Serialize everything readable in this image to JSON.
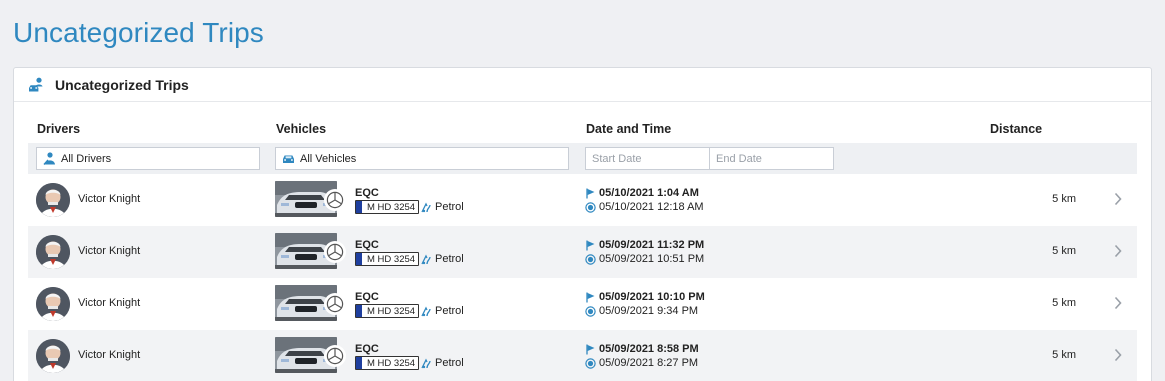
{
  "page": {
    "title": "Uncategorized Trips"
  },
  "card": {
    "title": "Uncategorized Trips",
    "header_icon": "car-user-icon"
  },
  "columns": {
    "drivers": "Drivers",
    "vehicles": "Vehicles",
    "date_time": "Date and Time",
    "distance": "Distance"
  },
  "filters": {
    "drivers": {
      "value": "All Drivers",
      "icon": "person-icon"
    },
    "vehicles": {
      "value": "All Vehicles",
      "icon": "car-icon"
    },
    "start_date": {
      "placeholder": "Start Date"
    },
    "end_date": {
      "placeholder": "End Date"
    }
  },
  "colors": {
    "accent": "#2f88c0",
    "plate_eu": "#1f3f9e"
  },
  "trips": [
    {
      "driver": "Victor Knight",
      "model": "EQC",
      "plate": "M HD 3254",
      "fuel": "Petrol",
      "end": "05/10/2021 1:04 AM",
      "start": "05/10/2021 12:18 AM",
      "distance": "5 km"
    },
    {
      "driver": "Victor Knight",
      "model": "EQC",
      "plate": "M HD 3254",
      "fuel": "Petrol",
      "end": "05/09/2021 11:32 PM",
      "start": "05/09/2021 10:51 PM",
      "distance": "5 km"
    },
    {
      "driver": "Victor Knight",
      "model": "EQC",
      "plate": "M HD 3254",
      "fuel": "Petrol",
      "end": "05/09/2021 10:10 PM",
      "start": "05/09/2021 9:34 PM",
      "distance": "5 km"
    },
    {
      "driver": "Victor Knight",
      "model": "EQC",
      "plate": "M HD 3254",
      "fuel": "Petrol",
      "end": "05/09/2021 8:58 PM",
      "start": "05/09/2021 8:27 PM",
      "distance": "5 km"
    }
  ]
}
